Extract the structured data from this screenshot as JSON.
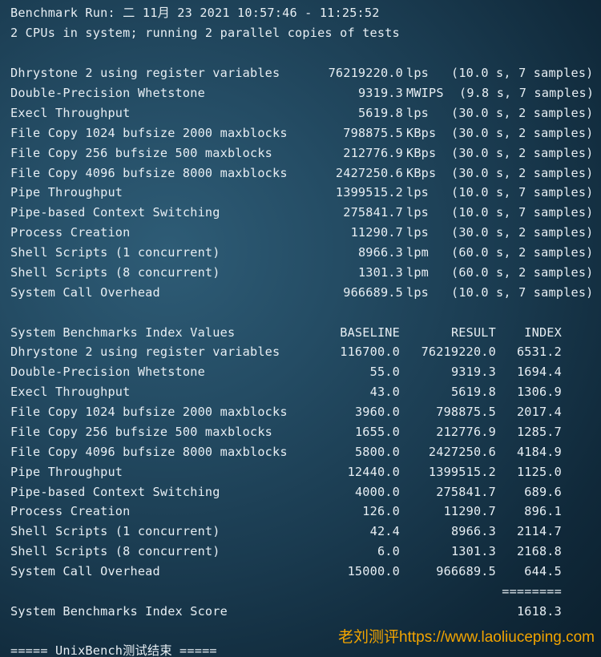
{
  "header": {
    "run_line": "Benchmark Run: 二 11月 23 2021 10:57:46 - 11:25:52",
    "cpu_line": "2 CPUs in system; running 2 parallel copies of tests"
  },
  "results": [
    {
      "name": "Dhrystone 2 using register variables",
      "value": "76219220.0",
      "unit": "lps",
      "detail": "(10.0 s, 7 samples)"
    },
    {
      "name": "Double-Precision Whetstone",
      "value": "9319.3",
      "unit": "MWIPS",
      "detail": "(9.8 s, 7 samples)"
    },
    {
      "name": "Execl Throughput",
      "value": "5619.8",
      "unit": "lps",
      "detail": "(30.0 s, 2 samples)"
    },
    {
      "name": "File Copy 1024 bufsize 2000 maxblocks",
      "value": "798875.5",
      "unit": "KBps",
      "detail": "(30.0 s, 2 samples)"
    },
    {
      "name": "File Copy 256 bufsize 500 maxblocks",
      "value": "212776.9",
      "unit": "KBps",
      "detail": "(30.0 s, 2 samples)"
    },
    {
      "name": "File Copy 4096 bufsize 8000 maxblocks",
      "value": "2427250.6",
      "unit": "KBps",
      "detail": "(30.0 s, 2 samples)"
    },
    {
      "name": "Pipe Throughput",
      "value": "1399515.2",
      "unit": "lps",
      "detail": "(10.0 s, 7 samples)"
    },
    {
      "name": "Pipe-based Context Switching",
      "value": "275841.7",
      "unit": "lps",
      "detail": "(10.0 s, 7 samples)"
    },
    {
      "name": "Process Creation",
      "value": "11290.7",
      "unit": "lps",
      "detail": "(30.0 s, 2 samples)"
    },
    {
      "name": "Shell Scripts (1 concurrent)",
      "value": "8966.3",
      "unit": "lpm",
      "detail": "(60.0 s, 2 samples)"
    },
    {
      "name": "Shell Scripts (8 concurrent)",
      "value": "1301.3",
      "unit": "lpm",
      "detail": "(60.0 s, 2 samples)"
    },
    {
      "name": "System Call Overhead",
      "value": "966689.5",
      "unit": "lps",
      "detail": "(10.0 s, 7 samples)"
    }
  ],
  "index_table": {
    "title": "System Benchmarks Index Values",
    "col_baseline": "BASELINE",
    "col_result": "RESULT",
    "col_index": "INDEX",
    "rows": [
      {
        "name": "Dhrystone 2 using register variables",
        "baseline": "116700.0",
        "result": "76219220.0",
        "index": "6531.2"
      },
      {
        "name": "Double-Precision Whetstone",
        "baseline": "55.0",
        "result": "9319.3",
        "index": "1694.4"
      },
      {
        "name": "Execl Throughput",
        "baseline": "43.0",
        "result": "5619.8",
        "index": "1306.9"
      },
      {
        "name": "File Copy 1024 bufsize 2000 maxblocks",
        "baseline": "3960.0",
        "result": "798875.5",
        "index": "2017.4"
      },
      {
        "name": "File Copy 256 bufsize 500 maxblocks",
        "baseline": "1655.0",
        "result": "212776.9",
        "index": "1285.7"
      },
      {
        "name": "File Copy 4096 bufsize 8000 maxblocks",
        "baseline": "5800.0",
        "result": "2427250.6",
        "index": "4184.9"
      },
      {
        "name": "Pipe Throughput",
        "baseline": "12440.0",
        "result": "1399515.2",
        "index": "1125.0"
      },
      {
        "name": "Pipe-based Context Switching",
        "baseline": "4000.0",
        "result": "275841.7",
        "index": "689.6"
      },
      {
        "name": "Process Creation",
        "baseline": "126.0",
        "result": "11290.7",
        "index": "896.1"
      },
      {
        "name": "Shell Scripts (1 concurrent)",
        "baseline": "42.4",
        "result": "8966.3",
        "index": "2114.7"
      },
      {
        "name": "Shell Scripts (8 concurrent)",
        "baseline": "6.0",
        "result": "1301.3",
        "index": "2168.8"
      },
      {
        "name": "System Call Overhead",
        "baseline": "15000.0",
        "result": "966689.5",
        "index": "644.5"
      }
    ],
    "separator": "========",
    "score_label": "System Benchmarks Index Score",
    "score_value": "1618.3"
  },
  "footer_line": "===== UnixBench测试结束 =====",
  "watermark": "老刘测评https://www.laoliuceping.com"
}
